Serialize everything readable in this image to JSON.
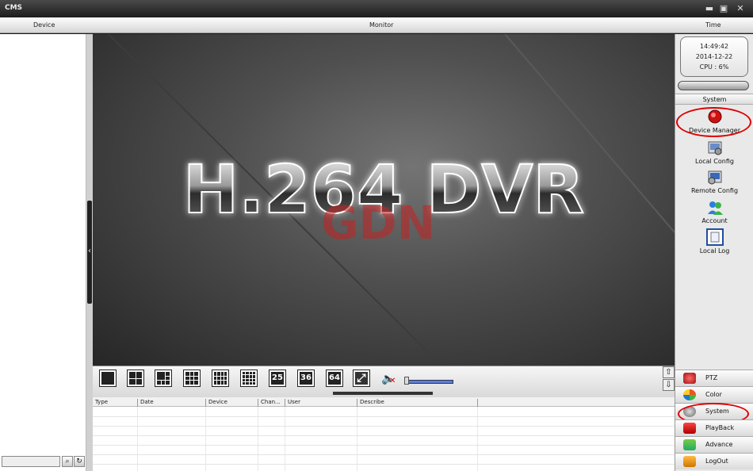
{
  "window": {
    "title": "CMS"
  },
  "header": {
    "device_label": "Device",
    "monitor_label": "Monitor",
    "time_label": "Time"
  },
  "video": {
    "logo_text": "H.264 DVR",
    "watermark_text": "GDN"
  },
  "toolbar": {
    "layout_25": "25",
    "layout_36": "36",
    "layout_64": "64"
  },
  "log": {
    "columns": [
      "Type",
      "Date",
      "Device",
      "Chan...",
      "User",
      "Describe"
    ]
  },
  "status": {
    "time": "14:49:42",
    "date": "2014-12-22",
    "cpu": "CPU : 6%"
  },
  "system": {
    "heading": "System",
    "items": [
      {
        "label": "Device Manager",
        "icon": "device-manager-icon"
      },
      {
        "label": "Local Config",
        "icon": "local-config-icon"
      },
      {
        "label": "Remote Config",
        "icon": "remote-config-icon"
      },
      {
        "label": "Account",
        "icon": "account-icon"
      },
      {
        "label": "Local Log",
        "icon": "local-log-icon"
      }
    ]
  },
  "nav": [
    {
      "label": "PTZ",
      "icon": "ptz-icon"
    },
    {
      "label": "Color",
      "icon": "color-icon"
    },
    {
      "label": "System",
      "icon": "system-icon"
    },
    {
      "label": "PlayBack",
      "icon": "playback-icon"
    },
    {
      "label": "Advance",
      "icon": "advance-icon"
    },
    {
      "label": "LogOut",
      "icon": "logout-icon"
    }
  ],
  "colors": {
    "highlight_oval": "#dd0000",
    "volume_bar": "#5b7fd3"
  }
}
